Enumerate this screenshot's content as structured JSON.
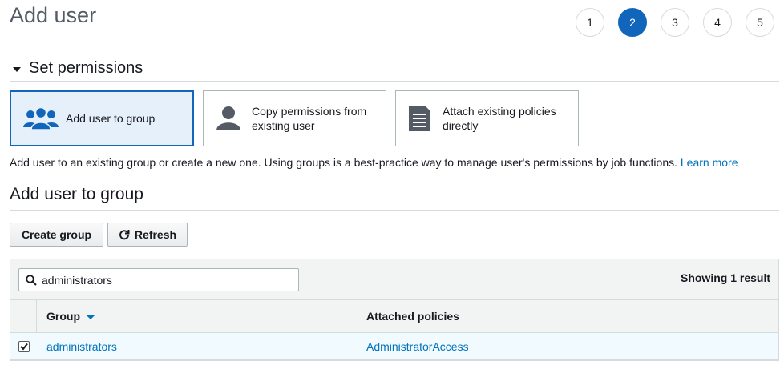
{
  "page": {
    "title": "Add user"
  },
  "steps": [
    "1",
    "2",
    "3",
    "4",
    "5"
  ],
  "active_step": "2",
  "section": {
    "title": "Set permissions"
  },
  "options": [
    {
      "label": "Add user to group",
      "selected": true,
      "icon": "group-icon"
    },
    {
      "label": "Copy permissions from existing user",
      "selected": false,
      "icon": "user-icon"
    },
    {
      "label": "Attach existing policies directly",
      "selected": false,
      "icon": "document-icon"
    }
  ],
  "description": {
    "text": "Add user to an existing group or create a new one. Using groups is a best-practice way to manage user's permissions by job functions.",
    "link": "Learn more"
  },
  "group_section": {
    "title": "Add user to group"
  },
  "toolbar": {
    "create_label": "Create group",
    "refresh_label": "Refresh"
  },
  "table": {
    "search_value": "administrators",
    "showing": "Showing 1 result",
    "columns": [
      "Group",
      "Attached policies"
    ],
    "rows": [
      {
        "group": "administrators",
        "policies": "AdministratorAccess",
        "checked": true
      }
    ]
  },
  "colors": {
    "accent": "#1166bb",
    "link": "#0073bb",
    "selected_bg": "#e6f0fa"
  }
}
